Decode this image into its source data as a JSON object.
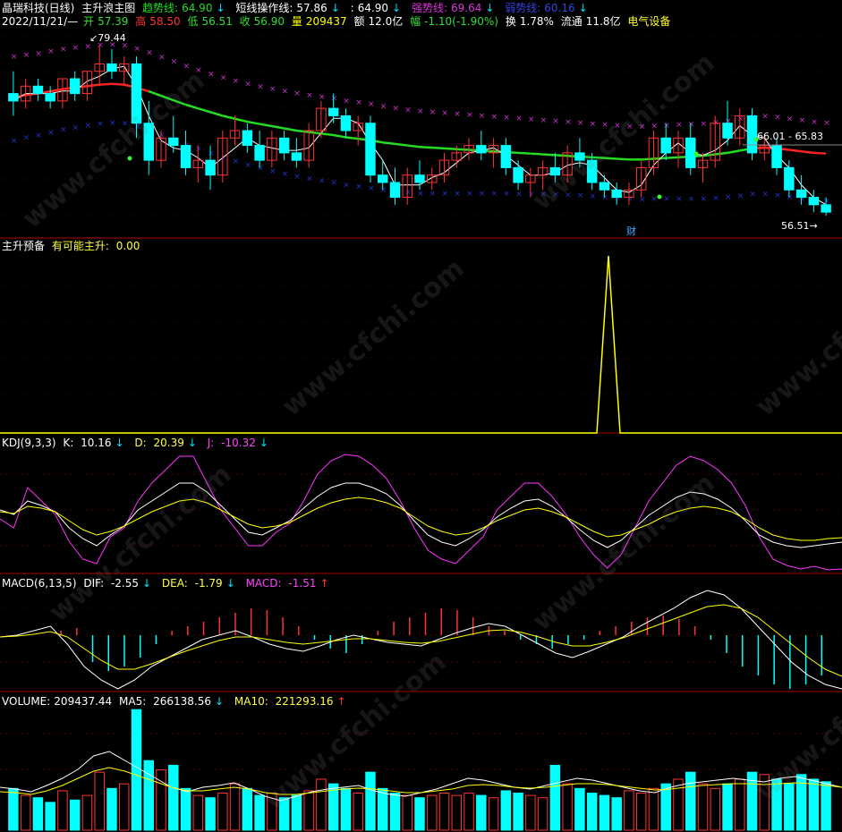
{
  "colors": {
    "up": "#ff3333",
    "down": "#00ffff",
    "bg": "#000000",
    "divider": "#aa0000",
    "trend_line_up": "#ff2222",
    "trend_line_dn": "#22dd22",
    "short_line": "#ffffff",
    "strong_line": "#cc33cc",
    "weak_line": "#2233cc",
    "yellow": "#ffff00",
    "magenta": "#ff33ff"
  },
  "header": {
    "stock": "晶瑞科技(日线)",
    "indicator": "主升浪主图",
    "trend_label": "趋势线:",
    "trend_value": "64.90",
    "short_label": "短线操作线:",
    "short_value": "57.86",
    "blank_label": ":",
    "blank_value": "64.90",
    "strong_label": "强势线:",
    "strong_value": "69.64",
    "weak_label": "弱势线:",
    "weak_value": "60.16"
  },
  "quote": {
    "date": "2022/11/21/—",
    "open_label": "开",
    "open": "57.39",
    "high_label": "高",
    "high": "58.50",
    "low_label": "低",
    "low": "56.51",
    "close_label": "收",
    "close": "56.90",
    "vol_label": "量",
    "vol": "209437",
    "amt_label": "额",
    "amt": "12.0亿",
    "chg_label": "幅",
    "chg": "-1.10(-1.90%)",
    "turn_label": "换",
    "turn": "1.78%",
    "float_label": "流通",
    "float": "11.8亿",
    "sector": "电气设备"
  },
  "price_labels": {
    "high_mark": "79.44",
    "low_mark": "56.51",
    "range": "66.01 - 65.83",
    "fin_mark": "财"
  },
  "panel2": {
    "title": "主升预备",
    "line_label": "有可能主升:",
    "line_value": "0.00"
  },
  "kdj": {
    "title": "KDJ(9,3,3)",
    "k_label": "K:",
    "k": "10.16",
    "d_label": "D:",
    "d": "20.39",
    "j_label": "J:",
    "j": "-10.32"
  },
  "macd": {
    "title": "MACD(6,13,5)",
    "dif_label": "DIF:",
    "dif": "-2.55",
    "dea_label": "DEA:",
    "dea": "-1.79",
    "macd_label": "MACD:",
    "macd": "-1.51"
  },
  "volume": {
    "title": "VOLUME:",
    "vol": "209437.44",
    "ma5_label": "MA5:",
    "ma5": "266138.56",
    "ma10_label": "MA10:",
    "ma10": "221293.16"
  },
  "watermark": "www.cfchi.com",
  "chart_data": {
    "type": "candlestick",
    "candles": [
      [
        73,
        76,
        70,
        72
      ],
      [
        72,
        75,
        71,
        74
      ],
      [
        74,
        75,
        72,
        73
      ],
      [
        73,
        74,
        71,
        72
      ],
      [
        72,
        75,
        71,
        75
      ],
      [
        75,
        76,
        72,
        73
      ],
      [
        73,
        76,
        72,
        76
      ],
      [
        76,
        79.44,
        74,
        77
      ],
      [
        77,
        79,
        75,
        76
      ],
      [
        76,
        78,
        74,
        77
      ],
      [
        77,
        78,
        67,
        69
      ],
      [
        69,
        72,
        62,
        64
      ],
      [
        64,
        68,
        63,
        67
      ],
      [
        67,
        70,
        65,
        66
      ],
      [
        66,
        68,
        62,
        63
      ],
      [
        63,
        66,
        61,
        64
      ],
      [
        64,
        66,
        60,
        62
      ],
      [
        62,
        68,
        61,
        67
      ],
      [
        67,
        70,
        66,
        68
      ],
      [
        68,
        69,
        65,
        66
      ],
      [
        66,
        68,
        63,
        64
      ],
      [
        64,
        68,
        63,
        67
      ],
      [
        67,
        68,
        64,
        65
      ],
      [
        65,
        67,
        63,
        64
      ],
      [
        64,
        69,
        63,
        68
      ],
      [
        68,
        72,
        67,
        71
      ],
      [
        71,
        73,
        69,
        70
      ],
      [
        70,
        71,
        67,
        68
      ],
      [
        68,
        70,
        66,
        69
      ],
      [
        69,
        70,
        61,
        62
      ],
      [
        62,
        64,
        60,
        61
      ],
      [
        61,
        63,
        58,
        59
      ],
      [
        59,
        63,
        58,
        62
      ],
      [
        62,
        64,
        60,
        61
      ],
      [
        61,
        63,
        60,
        62
      ],
      [
        62,
        65,
        61,
        64
      ],
      [
        64,
        66,
        63,
        65
      ],
      [
        65,
        67,
        64,
        66
      ],
      [
        66,
        68,
        64,
        65
      ],
      [
        65,
        67,
        63,
        66
      ],
      [
        66,
        67,
        62,
        63
      ],
      [
        63,
        64,
        60,
        61
      ],
      [
        61,
        63,
        59,
        62
      ],
      [
        62,
        64,
        60,
        63
      ],
      [
        63,
        65,
        61,
        62
      ],
      [
        62,
        66,
        61,
        65
      ],
      [
        65,
        67,
        63,
        64
      ],
      [
        64,
        65,
        60,
        61
      ],
      [
        61,
        62,
        59,
        60
      ],
      [
        60,
        61,
        58,
        59
      ],
      [
        59,
        61,
        58,
        60
      ],
      [
        60,
        64,
        59,
        63
      ],
      [
        63,
        68,
        62,
        67
      ],
      [
        67,
        69,
        64,
        65
      ],
      [
        65,
        68,
        63,
        67
      ],
      [
        67,
        69,
        62,
        63
      ],
      [
        63,
        65,
        61,
        64
      ],
      [
        64,
        70,
        63,
        69
      ],
      [
        69,
        72,
        66,
        67
      ],
      [
        67,
        71,
        66,
        70
      ],
      [
        70,
        71,
        64,
        65
      ],
      [
        65,
        67,
        64,
        66
      ],
      [
        66,
        67,
        62,
        63
      ],
      [
        63,
        64,
        59,
        60
      ],
      [
        60,
        62,
        58,
        59
      ],
      [
        59,
        60,
        57,
        58
      ],
      [
        58,
        59,
        56.51,
        57
      ]
    ],
    "trend_line": [
      72.5,
      72.8,
      73,
      73.3,
      73.6,
      73.8,
      74,
      74.2,
      74.3,
      74.2,
      73.8,
      73.3,
      72.7,
      72.1,
      71.5,
      71,
      70.5,
      70,
      69.6,
      69.2,
      68.9,
      68.6,
      68.3,
      68,
      67.8,
      67.6,
      67.4,
      67.1,
      66.9,
      66.7,
      66.4,
      66.2,
      66,
      65.8,
      65.7,
      65.6,
      65.5,
      65.4,
      65.3,
      65.2,
      65.1,
      65,
      64.9,
      64.8,
      64.7,
      64.6,
      64.5,
      64.4,
      64.3,
      64.2,
      64.1,
      64.1,
      64.2,
      64.3,
      64.4,
      64.5,
      64.6,
      64.8,
      65,
      65.3,
      65.6,
      65.7,
      65.6,
      65.4,
      65.2,
      65.0,
      64.9
    ],
    "panel2_series": [
      0,
      0,
      0,
      0,
      0,
      0,
      0,
      0,
      0,
      0,
      0,
      0,
      0,
      0,
      0,
      0,
      0,
      0,
      0,
      0,
      0,
      0,
      0,
      0,
      0,
      0,
      0,
      0,
      0,
      0,
      0,
      0,
      0,
      0,
      0,
      0,
      0,
      0,
      0,
      0,
      0,
      0,
      0,
      0,
      0,
      0,
      0,
      0,
      0,
      0,
      0,
      0,
      1,
      0,
      0,
      0,
      0,
      0,
      0,
      0,
      0,
      0,
      0,
      0,
      0,
      0,
      0
    ],
    "volume": [
      180,
      150,
      140,
      120,
      170,
      130,
      150,
      250,
      180,
      200,
      520,
      300,
      260,
      280,
      180,
      150,
      140,
      160,
      200,
      180,
      150,
      160,
      140,
      150,
      170,
      220,
      200,
      180,
      160,
      250,
      180,
      160,
      150,
      140,
      150,
      160,
      150,
      160,
      150,
      140,
      170,
      160,
      150,
      140,
      280,
      200,
      180,
      160,
      150,
      140,
      170,
      160,
      180,
      200,
      220,
      250,
      200,
      180,
      200,
      220,
      250,
      240,
      220,
      200,
      240,
      220,
      209
    ]
  }
}
